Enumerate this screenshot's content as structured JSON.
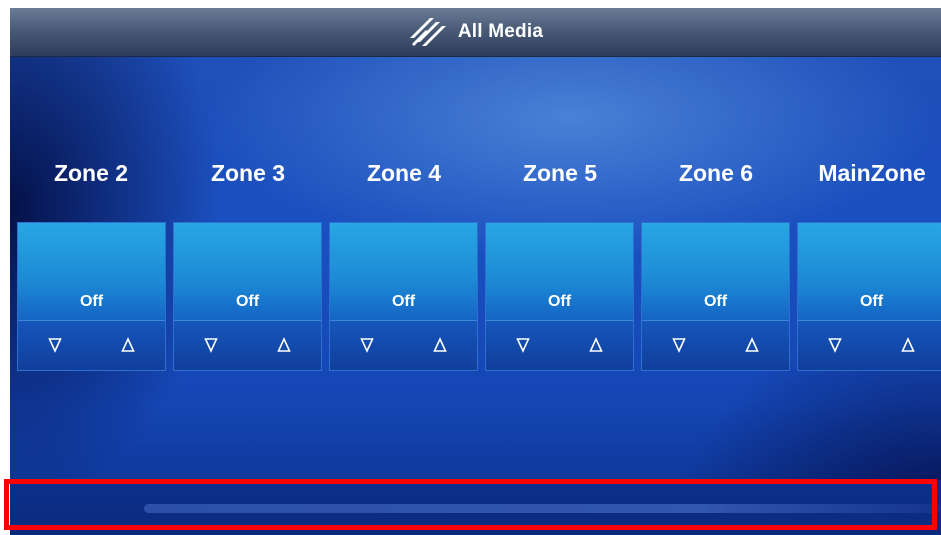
{
  "app": {
    "title": "All Media"
  },
  "icons": {
    "logo": "diagonal-stripes-logo-icon",
    "volume_down": "triangle-down-outline-icon",
    "volume_up": "triangle-up-outline-icon"
  },
  "colors": {
    "accent": "#1c89d5",
    "highlight": "#ff0000",
    "text": "#ffffff"
  },
  "zones": [
    {
      "name": "Zone 2",
      "status": "Off"
    },
    {
      "name": "Zone 3",
      "status": "Off"
    },
    {
      "name": "Zone 4",
      "status": "Off"
    },
    {
      "name": "Zone 5",
      "status": "Off"
    },
    {
      "name": "Zone 6",
      "status": "Off"
    },
    {
      "name": "MainZone",
      "status": "Off"
    }
  ]
}
